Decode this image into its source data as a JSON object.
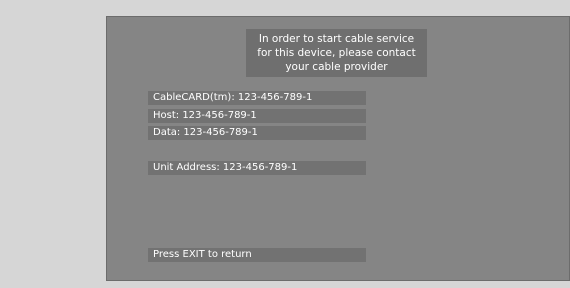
{
  "notice": {
    "lines": [
      "In order to start cable service",
      "for this device, please contact",
      "your cable provider"
    ]
  },
  "fields": {
    "cablecard": "CableCARD(tm): 123-456-789-1",
    "host": "Host: 123-456-789-1",
    "data": "Data: 123-456-789-1",
    "unit_address": "Unit Address: 123-456-789-1"
  },
  "footer": {
    "exit_prompt": "Press EXIT to return"
  },
  "colors": {
    "page_background": "#d6d6d6",
    "screen_background": "#858585",
    "panel_background": "#727272",
    "text": "#ffffff"
  }
}
